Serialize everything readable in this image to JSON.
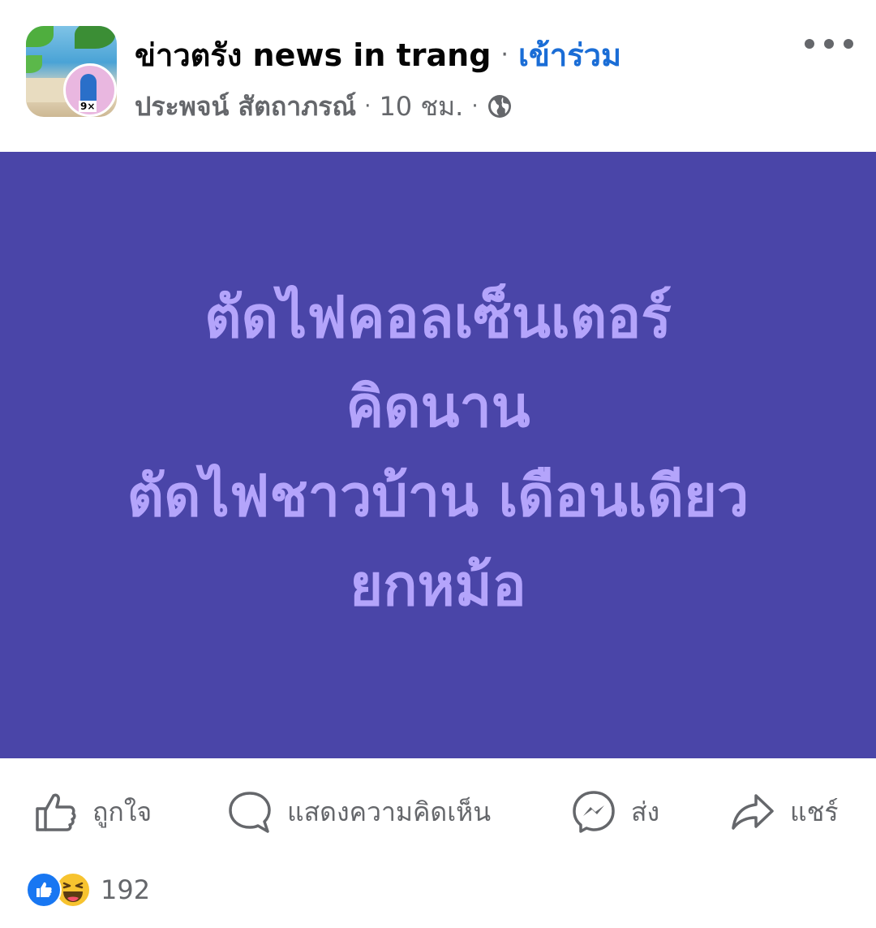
{
  "post": {
    "group_name": "ข่าวตรัง news in trang",
    "separator": "·",
    "join_label": "เข้าร่วม",
    "author": "ประพจน์ สัตถาภรณ์",
    "time": "10 ชม.",
    "privacy_icon": "globe-icon",
    "content_lines": [
      "ตัดไฟคอลเซ็นเตอร์",
      "คิดนาน",
      "ตัดไฟชาวบ้าน เดือนเดียว",
      "ยกหม้อ"
    ],
    "background_color": "#4a45a8",
    "text_color": "#b4a4fb"
  },
  "actions": {
    "like": "ถูกใจ",
    "comment": "แสดงความคิดเห็น",
    "send": "ส่ง",
    "share": "แชร์"
  },
  "reactions": {
    "icons": [
      "like-reaction-icon",
      "haha-reaction-icon"
    ],
    "count": "192"
  }
}
